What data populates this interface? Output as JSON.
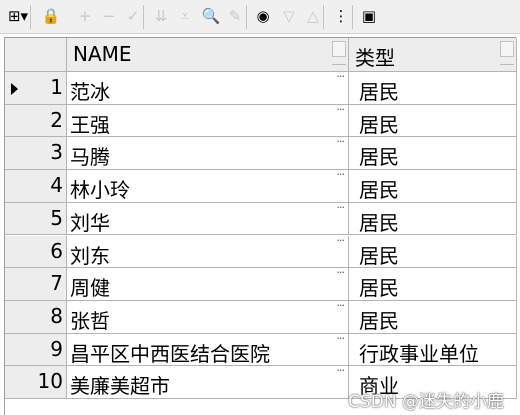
{
  "toolbar": {
    "buttons": [
      {
        "name": "grid-menu-icon",
        "glyph": "⊞▾",
        "disabled": false
      },
      {
        "name": "lock-icon",
        "glyph": "🔒",
        "disabled": false
      },
      {
        "name": "add-record-icon",
        "glyph": "+",
        "disabled": true
      },
      {
        "name": "delete-record-icon",
        "glyph": "−",
        "disabled": true
      },
      {
        "name": "post-edit-icon",
        "glyph": "✓",
        "disabled": true
      },
      {
        "name": "filter-down-icon",
        "glyph": "⇊",
        "disabled": true
      },
      {
        "name": "filter-clear-icon",
        "glyph": "⩡",
        "disabled": true
      },
      {
        "name": "find-binoculars-icon",
        "glyph": "🔍",
        "disabled": false
      },
      {
        "name": "clear-eraser-icon",
        "glyph": "✎",
        "disabled": true
      },
      {
        "name": "query-by-example-icon",
        "glyph": "◉",
        "disabled": false
      },
      {
        "name": "previous-record-icon",
        "glyph": "▽",
        "disabled": true
      },
      {
        "name": "next-record-icon",
        "glyph": "△",
        "disabled": true
      },
      {
        "name": "tree-view-icon",
        "glyph": "⋮",
        "disabled": false
      },
      {
        "name": "save-icon",
        "glyph": "▣",
        "disabled": false
      }
    ]
  },
  "columns": [
    "NAME",
    "类型"
  ],
  "rows": [
    {
      "num": "1",
      "name": "范冰",
      "type": "居民",
      "current": true
    },
    {
      "num": "2",
      "name": "王强",
      "type": "居民"
    },
    {
      "num": "3",
      "name": "马腾",
      "type": "居民"
    },
    {
      "num": "4",
      "name": "林小玲",
      "type": "居民"
    },
    {
      "num": "5",
      "name": "刘华",
      "type": "居民"
    },
    {
      "num": "6",
      "name": "刘东",
      "type": "居民"
    },
    {
      "num": "7",
      "name": "周健",
      "type": "居民"
    },
    {
      "num": "8",
      "name": "张哲",
      "type": "居民"
    },
    {
      "num": "9",
      "name": "昌平区中西医结合医院",
      "type": "行政事业单位"
    },
    {
      "num": "10",
      "name": "美廉美超市",
      "type": "商业"
    }
  ],
  "ellipsis": "···",
  "watermark": "CSDN @迷失的小鹿"
}
